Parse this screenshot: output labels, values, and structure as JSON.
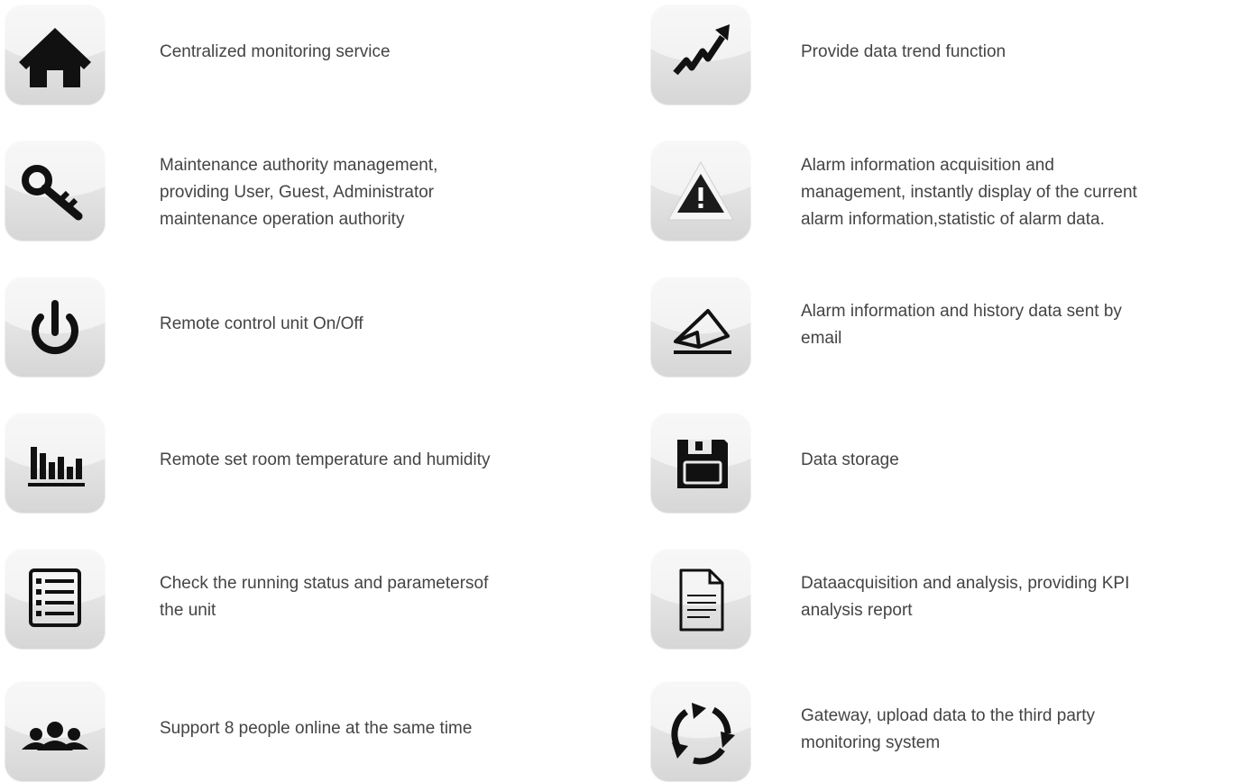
{
  "features": {
    "left": [
      {
        "icon": "home-icon",
        "text": "Centralized monitoring service"
      },
      {
        "icon": "key-icon",
        "text": "Maintenance authority management,\nproviding User, Guest, Administrator\nmaintenance operation authority"
      },
      {
        "icon": "power-icon",
        "text": "Remote control unit On/Off"
      },
      {
        "icon": "bar-chart-icon",
        "text": "Remote set room temperature and humidity"
      },
      {
        "icon": "list-icon",
        "text": "Check the running status and parametersof\nthe unit"
      },
      {
        "icon": "users-icon",
        "text": "Support 8 people online at the same time"
      }
    ],
    "right": [
      {
        "icon": "trend-icon",
        "text": "Provide data trend function"
      },
      {
        "icon": "warning-icon",
        "text": "Alarm information acquisition and\nmanagement, instantly display of the current\nalarm information,statistic of alarm data."
      },
      {
        "icon": "envelope-icon",
        "text": "Alarm information and history data sent by\nemail"
      },
      {
        "icon": "floppy-disk-icon",
        "text": "Data storage"
      },
      {
        "icon": "document-icon",
        "text": "Dataacquisition and analysis, providing KPI\nanalysis report"
      },
      {
        "icon": "refresh-cycle-icon",
        "text": "Gateway, upload data to the third party\nmonitoring system"
      }
    ]
  },
  "colors": {
    "icon": "#111111",
    "text": "#444444",
    "tile_top": "#eeeeee",
    "tile_bottom": "#d6d6d6"
  }
}
